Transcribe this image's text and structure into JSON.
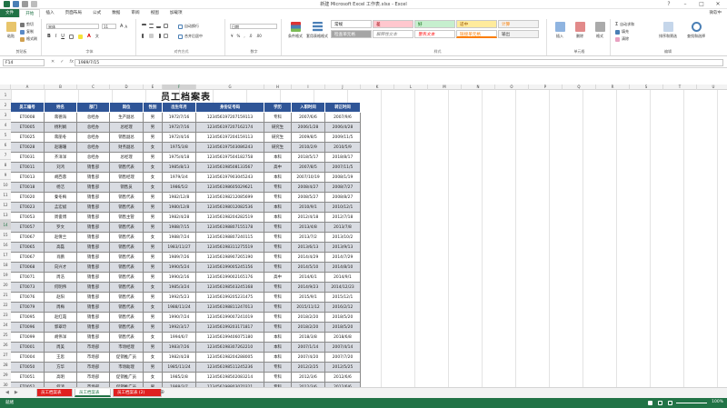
{
  "window": {
    "title": "新建 Microsoft Excel 工作表.xlsx - Excel",
    "user": "微软中"
  },
  "ribbon_tabs": [
    "文件",
    "开始",
    "插入",
    "页面布局",
    "公式",
    "数据",
    "审阅",
    "视图",
    "加载项"
  ],
  "ribbon": {
    "clipboard": {
      "label": "剪贴板",
      "paste": "粘贴",
      "cut": "剪切",
      "copy": "复制",
      "format_painter": "格式刷"
    },
    "font": {
      "label": "字体",
      "font_name": "宋体",
      "font_size": "11"
    },
    "alignment": {
      "label": "对齐方式",
      "wrap": "自动换行",
      "merge": "合并后居中"
    },
    "number": {
      "label": "数字",
      "format": "日期"
    },
    "cond_format": "条件格式",
    "table_format": "套用表格格式",
    "styles": {
      "label": "样式",
      "cells": [
        "常规",
        "差",
        "好",
        "适中",
        "计算",
        "检查单元格",
        "解释性文本",
        "警告文本",
        "链接单元格",
        "输出"
      ]
    },
    "cells": {
      "label": "单元格",
      "insert": "插入",
      "delete": "删除",
      "format": "格式"
    },
    "editing": {
      "label": "编辑",
      "autosum": "自动求和",
      "fill": "填充",
      "clear": "清除",
      "sort": "排序和筛选",
      "find": "查找和选择"
    }
  },
  "formula_bar": {
    "name_box": "F14",
    "value": "1989/7/15"
  },
  "columns": [
    "A",
    "B",
    "C",
    "D",
    "E",
    "F",
    "G",
    "H",
    "I",
    "J",
    "K",
    "L",
    "M",
    "N",
    "O",
    "P",
    "Q",
    "R",
    "S",
    "T",
    "U",
    "V"
  ],
  "rows": [
    "1",
    "2",
    "3",
    "4",
    "5",
    "6",
    "7",
    "8",
    "9",
    "10",
    "11",
    "12",
    "13",
    "14",
    "15",
    "16",
    "17",
    "18",
    "19",
    "20",
    "21",
    "22",
    "23",
    "24",
    "25",
    "26",
    "27",
    "28",
    "29",
    "30"
  ],
  "sheet": {
    "title": "员工档案表",
    "headers": [
      "员工编号",
      "姓名",
      "部门",
      "岗位",
      "性别",
      "出生年月",
      "身份证号码",
      "学历",
      "入职时间",
      "转正时间"
    ],
    "records": [
      [
        "ET0008",
        "蒋德海",
        "总经办",
        "生产副总",
        "男",
        "1972/7/16",
        "123456197207159113",
        "专科",
        "2007/6/6",
        "2007/9/6"
      ],
      [
        "ET0005",
        "杨利娟",
        "总经办",
        "总经理",
        "男",
        "1972/7/16",
        "123456197207162174",
        "研究生",
        "2006/1/28",
        "2006/4/28"
      ],
      [
        "ET0025",
        "蒋丽冬",
        "总经办",
        "销售副总",
        "男",
        "1972/4/16",
        "123456197204159113",
        "研究生",
        "2009/8/5",
        "2009/11/5"
      ],
      [
        "ET0028",
        "赵珊珊",
        "总经办",
        "财务副总",
        "女",
        "1975/3/8",
        "123456197503086243",
        "研究生",
        "2010/2/9",
        "2010/5/9"
      ],
      [
        "ET0031",
        "齐洋洋",
        "总经办",
        "总经理",
        "男",
        "1975/4/18",
        "123456197504182758",
        "本科",
        "2018/5/17",
        "2018/8/17"
      ],
      [
        "ET0011",
        "刘鸿",
        "销售部",
        "销售代表",
        "女",
        "1985/8/13",
        "123456198508133567",
        "高中",
        "2007/8/5",
        "2007/11/5"
      ],
      [
        "ET0013",
        "胡西蓉",
        "销售部",
        "销售经理",
        "女",
        "1979/3/4",
        "123456197903045243",
        "本科",
        "2007/10/19",
        "2008/1/19"
      ],
      [
        "ET0018",
        "杨洁",
        "销售部",
        "销售员",
        "女",
        "1986/5/2",
        "123456198605029621",
        "专科",
        "2008/4/27",
        "2008/7/27"
      ],
      [
        "ET0020",
        "秦冬梅",
        "销售部",
        "销售代表",
        "男",
        "1982/12/8",
        "123456198212085699",
        "专科",
        "2008/5/27",
        "2008/8/27"
      ],
      [
        "ET0023",
        "孟宏斌",
        "销售部",
        "销售代表",
        "男",
        "1980/12/8",
        "123456198012082536",
        "本科",
        "2010/9/1",
        "2010/12/1"
      ],
      [
        "ET0053",
        "周俊博",
        "销售部",
        "销售主管",
        "男",
        "1982/4/28",
        "123456198204282519",
        "本科",
        "2012/4/18",
        "2012/7/18"
      ],
      [
        "ET0057",
        "罗文",
        "销售部",
        "销售代表",
        "男",
        "1988/7/15",
        "123456198807155178",
        "专科",
        "2013/4/8",
        "2013/7/8"
      ],
      [
        "ET0067",
        "赵倩兰",
        "销售部",
        "销售代表",
        "女",
        "1988/7/24",
        "123456198807240115",
        "专科",
        "2013/7/2",
        "2013/10/2"
      ],
      [
        "ET0065",
        "高磊",
        "销售部",
        "销售代表",
        "男",
        "1983/11/27",
        "123456198311275519",
        "专科",
        "2013/6/13",
        "2013/9/13"
      ],
      [
        "ET0067",
        "肖鹏",
        "销售部",
        "销售代表",
        "男",
        "1989/7/26",
        "123456198907265190",
        "专科",
        "2014/4/29",
        "2014/7/29"
      ],
      [
        "ET0068",
        "向兴才",
        "销售部",
        "销售代表",
        "男",
        "1990/5/24",
        "123456199005245156",
        "专科",
        "2014/5/10",
        "2014/8/10"
      ],
      [
        "ET0071",
        "周浩",
        "销售部",
        "销售代表",
        "男",
        "1990/2/16",
        "123456199002165176",
        "高中",
        "2014/6/1",
        "2014/9/1"
      ],
      [
        "ET0073",
        "何明伟",
        "销售部",
        "销售代表",
        "女",
        "1985/3/24",
        "123456198503245168",
        "专科",
        "2014/9/23",
        "2014/12/23"
      ],
      [
        "ET0076",
        "赵阳",
        "销售部",
        "销售代表",
        "男",
        "1992/5/23",
        "123456199205231475",
        "专科",
        "2015/9/1",
        "2015/12/1"
      ],
      [
        "ET0079",
        "周梅",
        "销售部",
        "销售代表",
        "女",
        "1988/11/24",
        "123456198811247013",
        "专科",
        "2015/11/12",
        "2016/2/12"
      ],
      [
        "ET0095",
        "赵红霞",
        "销售部",
        "销售代表",
        "男",
        "1990/7/24",
        "123456199007241019",
        "专科",
        "2018/2/20",
        "2018/5/20"
      ],
      [
        "ET0096",
        "郭翠玲",
        "销售部",
        "销售代表",
        "男",
        "1992/3/17",
        "123456199203171817",
        "专科",
        "2018/2/20",
        "2018/5/20"
      ],
      [
        "ET0099",
        "胡伟洋",
        "销售部",
        "销售代表",
        "女",
        "1994/6/7",
        "123456199406075180",
        "本科",
        "2018/3/8",
        "2018/6/8"
      ],
      [
        "ET0001",
        "周美",
        "市场部",
        "市场经理",
        "男",
        "1983/7/26",
        "123456198307262210",
        "本科",
        "2007/1/14",
        "2007/4/14"
      ],
      [
        "ET0004",
        "王思",
        "市场部",
        "促销推广员",
        "女",
        "1982/4/28",
        "123456198204288005",
        "本科",
        "2007/4/20",
        "2007/7/20"
      ],
      [
        "ET0050",
        "方华",
        "市场部",
        "市场助理",
        "男",
        "1985/11/24",
        "123456198511245236",
        "专科",
        "2012/2/25",
        "2012/5/25"
      ],
      [
        "ET0051",
        "高明",
        "市场部",
        "促销推广员",
        "女",
        "1985/2/8",
        "123456198502083214",
        "专科",
        "2012/3/6",
        "2012/6/6"
      ],
      [
        "ET0052",
        "何鸿",
        "市场部",
        "促销推广员",
        "男",
        "1988/3/7",
        "123456198803070321",
        "专科",
        "2012/3/6",
        "2012/6/6"
      ]
    ]
  },
  "sheet_tabs": [
    "员工档案表",
    "员工档案表",
    "员工档案表 (2)"
  ],
  "status": {
    "mode": "就绪",
    "zoom": "100%"
  },
  "colors": {
    "accent": "#217346",
    "header": "#2f5597",
    "band": "#d9dce2",
    "tab_red": "#e02020"
  }
}
